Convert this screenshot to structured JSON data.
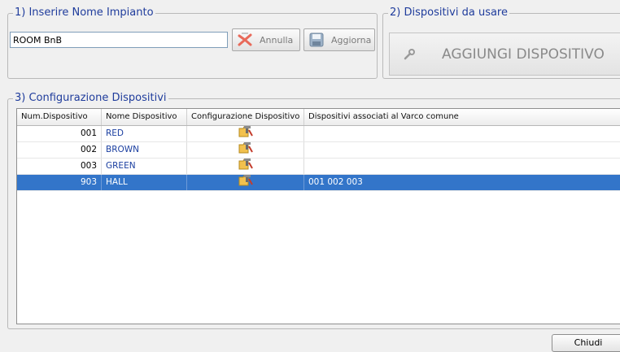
{
  "section1": {
    "legend": "1) Inserire Nome Impianto",
    "name_value": "ROOM BnB",
    "annulla_label": "Annulla",
    "aggiorna_label": "Aggiorna"
  },
  "section2": {
    "legend": "2) Dispositivi da usare",
    "add_label": "AGGIUNGI DISPOSITIVO"
  },
  "section3": {
    "legend": "3) Configurazione Dispositivi",
    "columns": [
      "Num.Dispositivo",
      "Nome Dispositivo",
      "Configurazione Dispositivo",
      "Dispositivi associati al Varco comune"
    ],
    "rows": [
      {
        "num": "001",
        "name": "RED",
        "assoc": "",
        "selected": false
      },
      {
        "num": "002",
        "name": "BROWN",
        "assoc": "",
        "selected": false
      },
      {
        "num": "003",
        "name": "GREEN",
        "assoc": "",
        "selected": false
      },
      {
        "num": "903",
        "name": "HALL",
        "assoc": "001  002  003",
        "selected": true
      }
    ],
    "config_icon": "folder-tools-icon"
  },
  "footer": {
    "close_label": "Chiudi"
  },
  "colors": {
    "legend_text": "#1f3c9c",
    "selection": "#3375c9",
    "device_name": "#1a3ea0"
  }
}
